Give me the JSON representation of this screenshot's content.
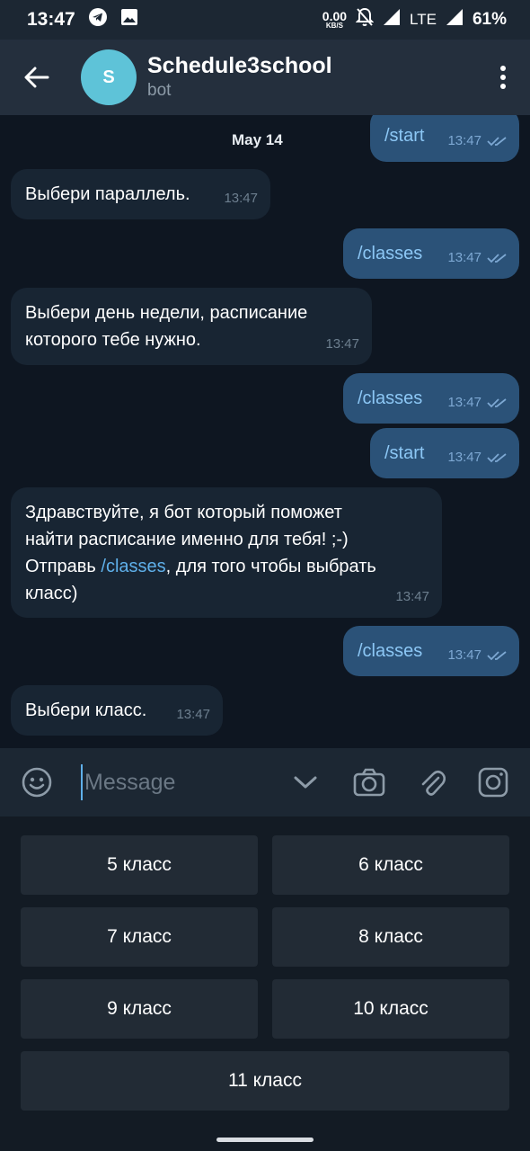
{
  "status_bar": {
    "time": "13:47",
    "net_speed": "0.00",
    "net_unit": "KB/S",
    "network": "LTE",
    "battery": "61%"
  },
  "header": {
    "avatar_letter": "S",
    "title": "Schedule3school",
    "subtitle": "bot"
  },
  "chat": {
    "date": "May 14",
    "messages": [
      {
        "dir": "out",
        "text": "/start",
        "time": "13:47"
      },
      {
        "dir": "in",
        "text": "Выбери параллель.",
        "time": "13:47"
      },
      {
        "dir": "out",
        "text": "/classes",
        "time": "13:47"
      },
      {
        "dir": "in",
        "line1": "Выбери день недели, расписание",
        "line2": "которого тебе нужно.",
        "time": "13:47"
      },
      {
        "dir": "out",
        "text": "/classes",
        "time": "13:47"
      },
      {
        "dir": "out",
        "text": "/start",
        "time": "13:47"
      },
      {
        "dir": "in",
        "line1": "Здравствуйте, я бот который поможет",
        "line2": "найти расписание именно для тебя! ;-)",
        "line3_pre": "Отправь ",
        "line3_cmd": "/classes",
        "line3_post": ", для того чтобы выбрать",
        "line4": "класс)",
        "time": "13:47"
      },
      {
        "dir": "out",
        "text": "/classes",
        "time": "13:47"
      },
      {
        "dir": "in",
        "text": "Выбери класс.",
        "time": "13:47"
      }
    ]
  },
  "input": {
    "placeholder": "Message"
  },
  "keyboard": {
    "buttons": [
      "5 класс",
      "6 класс",
      "7 класс",
      "8 класс",
      "9 класс",
      "10 класс",
      "11 класс"
    ]
  }
}
